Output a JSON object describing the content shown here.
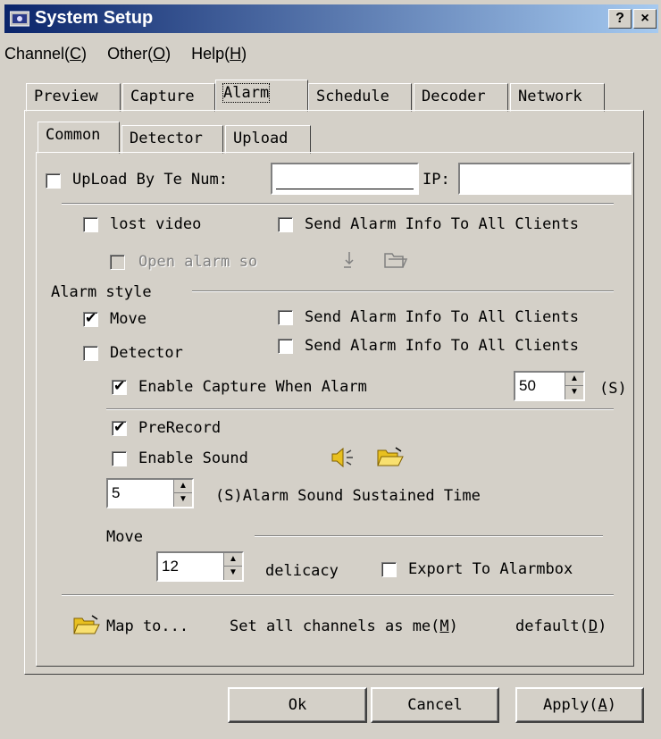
{
  "window": {
    "title": "System Setup",
    "help_btn": "?",
    "close_btn": "×"
  },
  "menu": [
    {
      "label": "Channel(",
      "key": "C",
      "end": ")"
    },
    {
      "label": "Other(",
      "key": "O",
      "end": ")"
    },
    {
      "label": "Help(",
      "key": "H",
      "end": ")"
    }
  ],
  "tabs": [
    "Preview",
    "Capture",
    "Alarm",
    "Schedule",
    "Decoder",
    "Network"
  ],
  "subtabs": [
    "Common",
    "Detector",
    "Upload"
  ],
  "upload": {
    "label": "UpLoad By Te Num:",
    "ip_label": "IP:"
  },
  "lost_video": {
    "label": "lost video",
    "send_all": "Send Alarm Info To All Clients",
    "open_sound": "Open alarm so"
  },
  "alarm_style": {
    "heading": "Alarm style",
    "move": "Move",
    "move_send": "Send Alarm Info To All Clients",
    "detector": "Detector",
    "detector_send": "Send Alarm Info To All Clients",
    "enable_capture": "Enable Capture When Alarm",
    "capture_value": "50",
    "capture_unit": "(S)"
  },
  "prerecord": "PreRecord",
  "enable_sound": "Enable Sound",
  "sound_time": {
    "value": "5",
    "label": "(S)Alarm Sound Sustained Time"
  },
  "move_section": {
    "heading": "Move",
    "value": "12",
    "delicacy": "delicacy",
    "export": "Export To Alarmbox"
  },
  "bottom_row": {
    "map_to": "Map to...",
    "set_all": "Set all channels as me(",
    "set_all_key": "M",
    "default": "default(",
    "default_key": "D"
  },
  "buttons": {
    "ok": "Ok",
    "cancel": "Cancel",
    "apply": "Apply(",
    "apply_key": "A"
  }
}
